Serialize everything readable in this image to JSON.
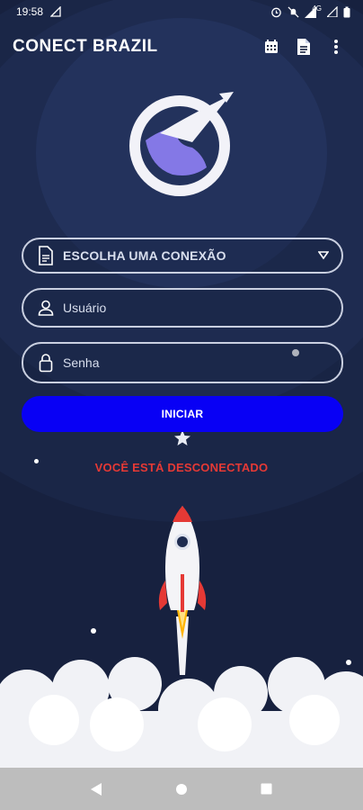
{
  "status_bar": {
    "time": "19:58",
    "network_label": "4G",
    "icons": [
      "signal-alt-icon",
      "alarm-icon",
      "mute-icon",
      "signal-icon",
      "battery-icon"
    ]
  },
  "app_bar": {
    "title": "CONECT BRAZIL",
    "actions": [
      "calendar-icon",
      "document-icon",
      "more-vert-icon"
    ]
  },
  "form": {
    "connection_select": {
      "selected": "ESCOLHA UMA CONEXÃO",
      "icon": "file-icon"
    },
    "username": {
      "placeholder": "Usuário",
      "value": "",
      "icon": "person-icon"
    },
    "password": {
      "placeholder": "Senha",
      "value": "",
      "icon": "lock-icon"
    },
    "start_button": "INICIAR"
  },
  "connection_status": "VOCÊ ESTÁ DESCONECTADO",
  "colors": {
    "background": "#17213f",
    "button": "#0800f5",
    "status_text": "#e53935",
    "logo_purple": "#8478e6"
  },
  "nav_bar": [
    "back-icon",
    "home-icon",
    "recents-icon"
  ]
}
